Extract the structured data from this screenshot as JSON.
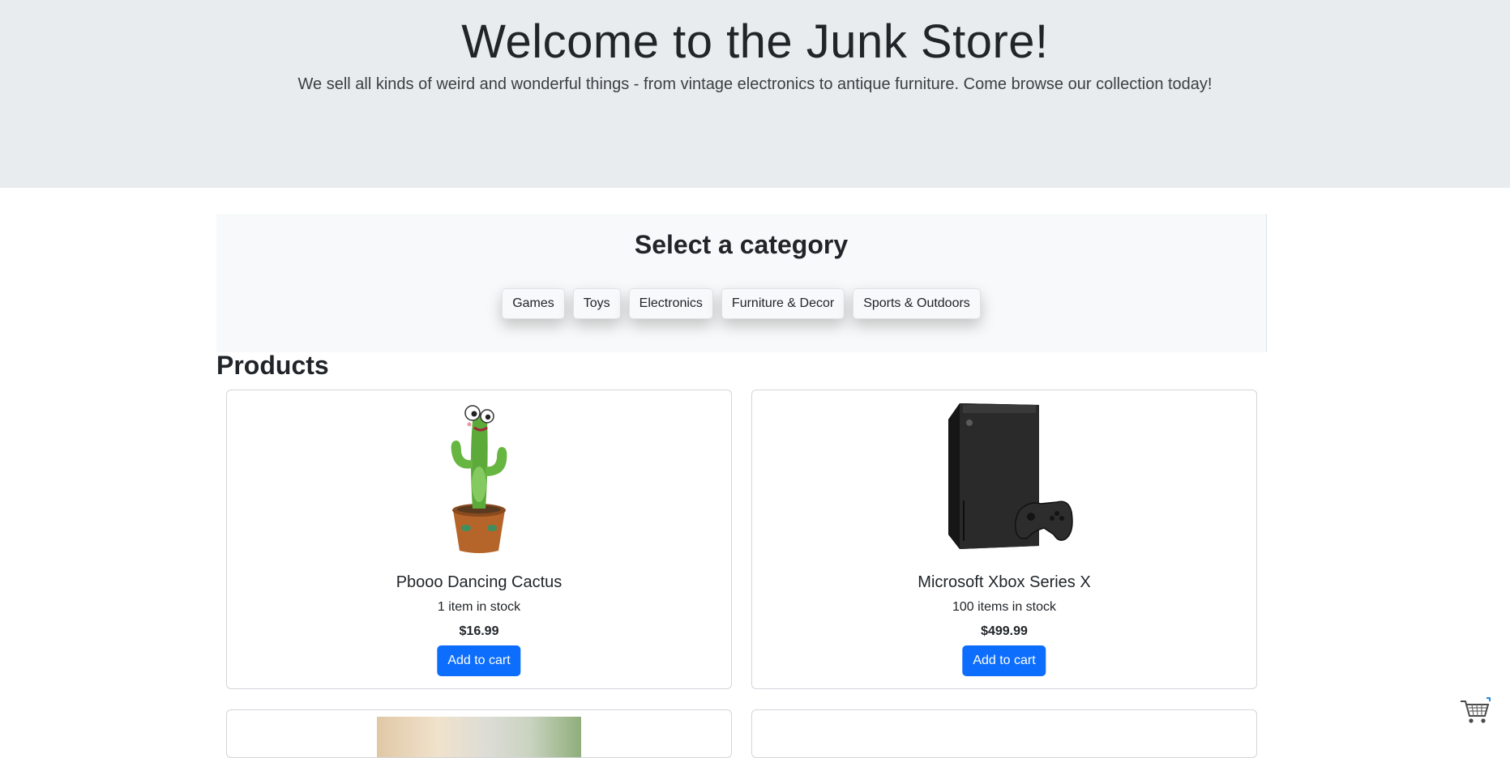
{
  "hero": {
    "title": "Welcome to the Junk Store!",
    "subtitle": "We sell all kinds of weird and wonderful things - from vintage electronics to antique furniture. Come browse our collection today!"
  },
  "categories": {
    "heading": "Select a category",
    "items": [
      "Games",
      "Toys",
      "Electronics",
      "Furniture & Decor",
      "Sports & Outdoors"
    ]
  },
  "products": {
    "heading": "Products",
    "items": [
      {
        "name": "Pbooo Dancing Cactus",
        "stock": "1 item in stock",
        "price": "$16.99",
        "button": "Add to cart",
        "image_icon": "dancing-cactus"
      },
      {
        "name": "Microsoft Xbox Series X",
        "stock": "100 items in stock",
        "price": "$499.99",
        "button": "Add to cart",
        "image_icon": "xbox-series-x"
      }
    ]
  },
  "cart": {
    "icon": "shopping-cart-icon"
  },
  "colors": {
    "primary": "#0d6efd",
    "hero_bg": "#e9ecef",
    "panel_bg": "#f8f9fa"
  }
}
